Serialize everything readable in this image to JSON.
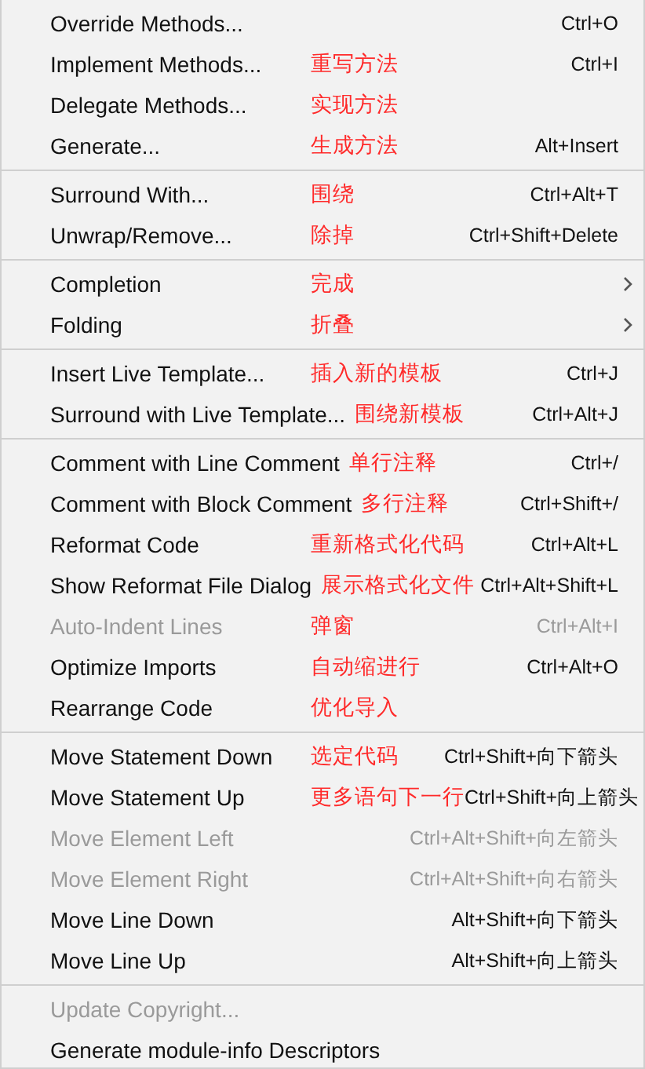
{
  "menu": {
    "groups": [
      {
        "items": [
          {
            "label": "Override Methods...",
            "shortcut": "Ctrl+O",
            "kind": "action",
            "disabled": false
          },
          {
            "label": "Implement Methods...",
            "shortcut": "Ctrl+I",
            "kind": "action",
            "disabled": false
          },
          {
            "label": "Delegate Methods...",
            "kind": "action",
            "disabled": false
          },
          {
            "label": "Generate...",
            "shortcut": "Alt+Insert",
            "kind": "action",
            "disabled": false
          }
        ]
      },
      {
        "items": [
          {
            "label": "Surround With...",
            "shortcut": "Ctrl+Alt+T",
            "kind": "action",
            "disabled": false
          },
          {
            "label": "Unwrap/Remove...",
            "shortcut": "Ctrl+Shift+Delete",
            "kind": "action",
            "disabled": false
          }
        ]
      },
      {
        "items": [
          {
            "label": "Completion",
            "kind": "submenu",
            "disabled": false
          },
          {
            "label": "Folding",
            "kind": "submenu",
            "disabled": false
          }
        ]
      },
      {
        "items": [
          {
            "label": "Insert Live Template...",
            "shortcut": "Ctrl+J",
            "kind": "action",
            "disabled": false
          },
          {
            "label": "Surround with Live Template...",
            "shortcut": "Ctrl+Alt+J",
            "kind": "action",
            "disabled": false
          }
        ]
      },
      {
        "items": [
          {
            "label": "Comment with Line Comment",
            "shortcut": "Ctrl+/",
            "kind": "action",
            "disabled": false
          },
          {
            "label": "Comment with Block Comment",
            "shortcut": "Ctrl+Shift+/",
            "kind": "action",
            "disabled": false
          },
          {
            "label": "Reformat Code",
            "shortcut": "Ctrl+Alt+L",
            "kind": "action",
            "disabled": false
          },
          {
            "label": "Show Reformat File Dialog",
            "shortcut": "Ctrl+Alt+Shift+L",
            "kind": "action",
            "disabled": false
          },
          {
            "label": "Auto-Indent Lines",
            "shortcut": "Ctrl+Alt+I",
            "kind": "action",
            "disabled": true
          },
          {
            "label": "Optimize Imports",
            "shortcut": "Ctrl+Alt+O",
            "kind": "action",
            "disabled": false
          },
          {
            "label": "Rearrange Code",
            "kind": "action",
            "disabled": false
          }
        ]
      },
      {
        "items": [
          {
            "label": "Move Statement Down",
            "shortcut": "Ctrl+Shift+向下箭头",
            "kind": "action",
            "disabled": false
          },
          {
            "label": "Move Statement Up",
            "shortcut": "Ctrl+Shift+向上箭头",
            "kind": "action",
            "disabled": false
          },
          {
            "label": "Move Element Left",
            "shortcut": "Ctrl+Alt+Shift+向左箭头",
            "kind": "action",
            "disabled": true
          },
          {
            "label": "Move Element Right",
            "shortcut": "Ctrl+Alt+Shift+向右箭头",
            "kind": "action",
            "disabled": true
          },
          {
            "label": "Move Line Down",
            "shortcut": "Alt+Shift+向下箭头",
            "kind": "action",
            "disabled": false
          },
          {
            "label": "Move Line Up",
            "shortcut": "Alt+Shift+向上箭头",
            "kind": "action",
            "disabled": false
          }
        ]
      },
      {
        "items": [
          {
            "label": "Update Copyright...",
            "kind": "action",
            "disabled": true
          },
          {
            "label": "Generate module-info Descriptors",
            "kind": "action",
            "disabled": false
          }
        ]
      }
    ]
  },
  "annotations": [
    "重写方法",
    "实现方法",
    "生成方法",
    "围绕",
    "除掉",
    "完成",
    "折叠",
    "插入新的模板",
    "围绕新模板",
    "单行注释",
    "多行注释",
    "重新格式化代码",
    "展示格式化文件",
    "弹窗",
    "自动缩进行",
    "优化导入",
    "选定代码",
    "更多语句下一行"
  ]
}
